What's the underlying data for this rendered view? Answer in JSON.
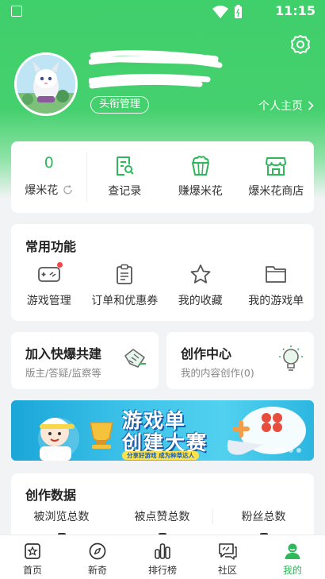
{
  "status_bar": {
    "time": "11:15"
  },
  "profile": {
    "title_badge": "头衔管理",
    "homepage_link": "个人主页"
  },
  "stats": [
    {
      "value": "0",
      "label": "爆米花"
    },
    {
      "label": "查记录",
      "icon": "record-search-icon"
    },
    {
      "label": "赚爆米花",
      "icon": "popcorn-icon"
    },
    {
      "label": "爆米花商店",
      "icon": "store-icon"
    }
  ],
  "functions": {
    "title": "常用功能",
    "items": [
      {
        "label": "游戏管理",
        "icon": "gamepad-icon"
      },
      {
        "label": "订单和优惠券",
        "icon": "clipboard-icon"
      },
      {
        "label": "我的收藏",
        "icon": "star-icon"
      },
      {
        "label": "我的游戏单",
        "icon": "folder-icon"
      }
    ]
  },
  "join": {
    "title": "加入快爆共建",
    "subtitle": "版主/答疑/监察等"
  },
  "creation_center": {
    "title": "创作中心",
    "subtitle": "我的内容创作(0)"
  },
  "banner": {
    "title_line1": "游戏单",
    "title_line2": "创建大赛",
    "subtitle": "分享好游戏  成为种草达人"
  },
  "creation_data": {
    "title": "创作数据",
    "items": [
      {
        "label": "被浏览总数"
      },
      {
        "label": "被点赞总数"
      },
      {
        "label": "粉丝总数"
      }
    ]
  },
  "tabbar": {
    "items": [
      {
        "label": "首页",
        "icon": "home-icon"
      },
      {
        "label": "新奇",
        "icon": "compass-icon"
      },
      {
        "label": "排行榜",
        "icon": "ranking-icon"
      },
      {
        "label": "社区",
        "icon": "community-icon"
      },
      {
        "label": "我的",
        "icon": "profile-icon",
        "active": true
      }
    ]
  },
  "colors": {
    "brand_green": "#3fcf6b",
    "accent_green": "#2fb75c",
    "badge_red": "#f04848"
  }
}
